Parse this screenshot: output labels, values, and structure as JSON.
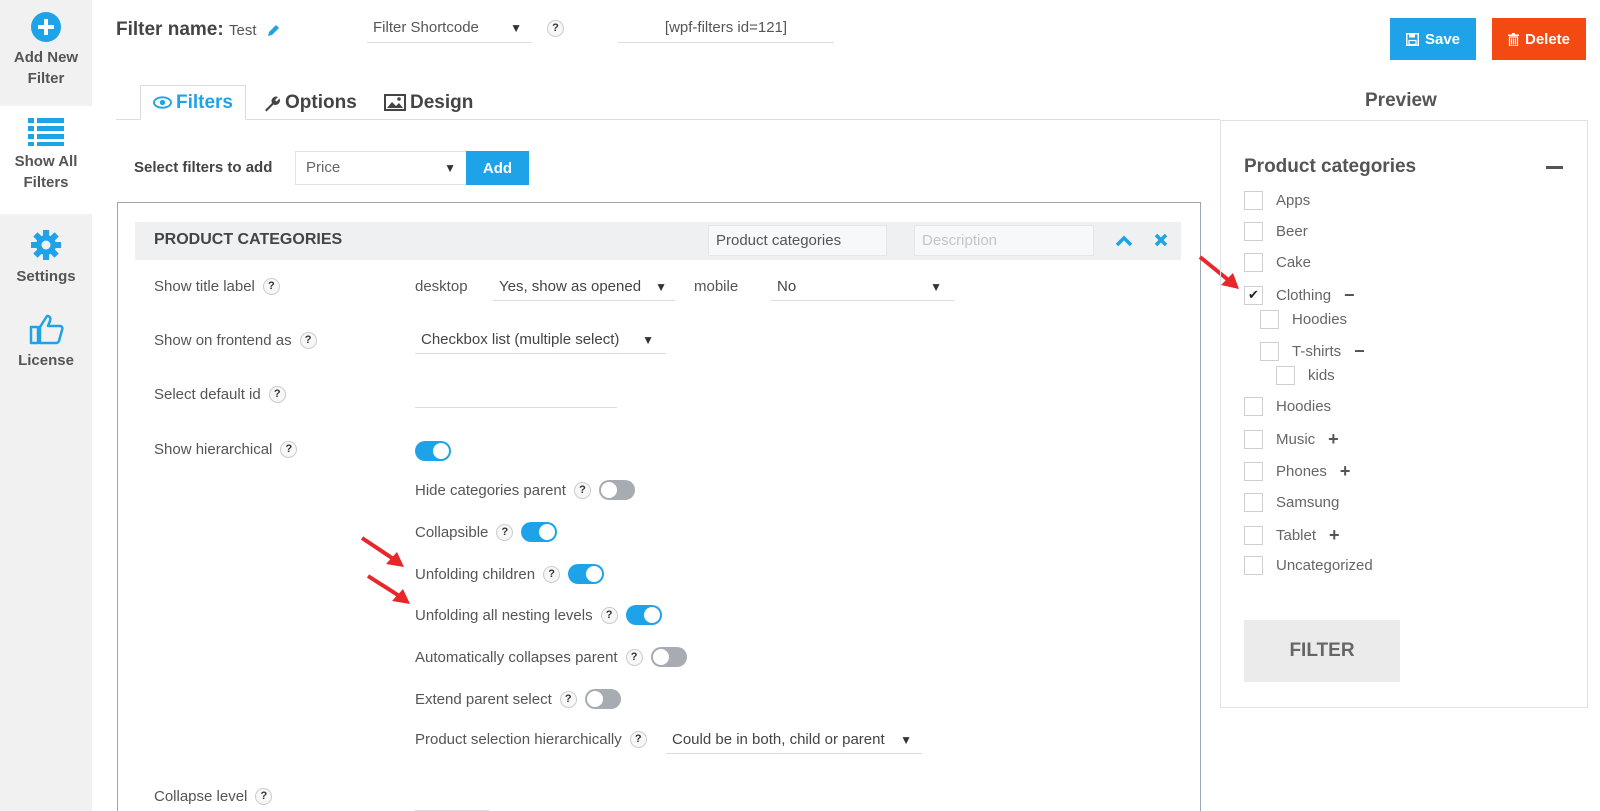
{
  "sidebar": {
    "items": [
      {
        "label_line1": "Add New",
        "label_line2": "Filter"
      },
      {
        "label_line1": "Show All",
        "label_line2": "Filters"
      },
      {
        "label_line1": "Settings"
      },
      {
        "label_line1": "License"
      }
    ]
  },
  "topbar": {
    "filter_name_label": "Filter name:",
    "filter_name_value": "Test",
    "shortcode_select": "Filter Shortcode",
    "shortcode_value": "[wpf-filters id=121]",
    "save_label": "Save",
    "delete_label": "Delete"
  },
  "tabs": [
    {
      "label": "Filters"
    },
    {
      "label": "Options"
    },
    {
      "label": "Design"
    }
  ],
  "preview_title": "Preview",
  "add_filter": {
    "label": "Select filters to add",
    "selected": "Price",
    "button": "Add"
  },
  "filter_block": {
    "title": "PRODUCT CATEGORIES",
    "title_input": "Product categories",
    "description_placeholder": "Description",
    "rows": {
      "show_title_label": "Show title label",
      "desktop_label": "desktop",
      "desktop_value": "Yes, show as opened",
      "mobile_label": "mobile",
      "mobile_value": "No",
      "show_frontend_as": "Show on frontend as",
      "frontend_value": "Checkbox list (multiple select)",
      "select_default_id": "Select default id",
      "show_hierarchical": "Show hierarchical",
      "hide_categories_parent": "Hide categories parent",
      "collapsible": "Collapsible",
      "unfolding_children": "Unfolding children",
      "unfolding_all": "Unfolding all nesting levels",
      "auto_collapses": "Automatically collapses parent",
      "extend_parent": "Extend parent select",
      "product_selection": "Product selection hierarchically",
      "product_selection_value": "Could be in both, child or parent",
      "collapse_level": "Collapse level"
    },
    "toggles": {
      "show_hierarchical": true,
      "hide_categories_parent": false,
      "collapsible": true,
      "unfolding_children": true,
      "unfolding_all": true,
      "auto_collapses": false,
      "extend_parent": false
    }
  },
  "preview": {
    "title": "Product categories",
    "items": [
      {
        "label": "Apps",
        "checked": false
      },
      {
        "label": "Beer",
        "checked": false
      },
      {
        "label": "Cake",
        "checked": false
      },
      {
        "label": "Clothing",
        "checked": true,
        "toggle": "−"
      },
      {
        "label": "Hoodies",
        "checked": false
      },
      {
        "label": "T-shirts",
        "checked": false,
        "toggle": "−"
      },
      {
        "label": "kids",
        "checked": false
      },
      {
        "label": "Hoodies",
        "checked": false
      },
      {
        "label": "Music",
        "checked": false,
        "toggle": "+"
      },
      {
        "label": "Phones",
        "checked": false,
        "toggle": "+"
      },
      {
        "label": "Samsung",
        "checked": false
      },
      {
        "label": "Tablet",
        "checked": false,
        "toggle": "+"
      },
      {
        "label": "Uncategorized",
        "checked": false
      }
    ],
    "filter_button": "FILTER"
  },
  "colors": {
    "accent": "#1fa3e8",
    "delete": "#f24a12",
    "arrow": "#e8272b"
  }
}
